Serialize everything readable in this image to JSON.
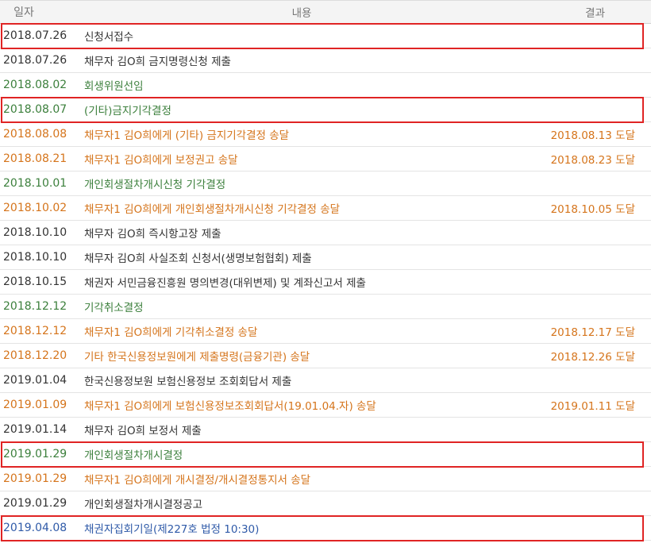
{
  "header": {
    "date": "일자",
    "content": "내용",
    "result": "결과"
  },
  "rows": [
    {
      "date": "2018.07.26",
      "content": "신청서접수",
      "result": "",
      "tone": "black",
      "highlighted": true
    },
    {
      "date": "2018.07.26",
      "content": "채무자 김O희 금지명령신청 제출",
      "result": "",
      "tone": "black",
      "highlighted": false
    },
    {
      "date": "2018.08.02",
      "content": "회생위원선임",
      "result": "",
      "tone": "green",
      "highlighted": false
    },
    {
      "date": "2018.08.07",
      "content": "(기타)금지기각결정",
      "result": "",
      "tone": "green",
      "highlighted": true
    },
    {
      "date": "2018.08.08",
      "content": "채무자1 김O희에게 (기타) 금지기각결정 송달",
      "result": "2018.08.13 도달",
      "tone": "orange",
      "highlighted": false
    },
    {
      "date": "2018.08.21",
      "content": "채무자1 김O희에게 보정권고 송달",
      "result": "2018.08.23 도달",
      "tone": "orange",
      "highlighted": false
    },
    {
      "date": "2018.10.01",
      "content": "개인회생절차개시신청 기각결정",
      "result": "",
      "tone": "green",
      "highlighted": false
    },
    {
      "date": "2018.10.02",
      "content": "채무자1 김O희에게 개인회생절차개시신청 기각결정 송달",
      "result": "2018.10.05 도달",
      "tone": "orange",
      "highlighted": false
    },
    {
      "date": "2018.10.10",
      "content": "채무자 김O희 즉시항고장 제출",
      "result": "",
      "tone": "black",
      "highlighted": false
    },
    {
      "date": "2018.10.10",
      "content": "채무자 김O희 사실조회 신청서(생명보험협회) 제출",
      "result": "",
      "tone": "black",
      "highlighted": false
    },
    {
      "date": "2018.10.15",
      "content": "채권자 서민금융진흥원 명의변경(대위변제) 및 계좌신고서 제출",
      "result": "",
      "tone": "black",
      "highlighted": false
    },
    {
      "date": "2018.12.12",
      "content": "기각취소결정",
      "result": "",
      "tone": "green",
      "highlighted": false
    },
    {
      "date": "2018.12.12",
      "content": "채무자1 김O희에게 기각취소결정 송달",
      "result": "2018.12.17 도달",
      "tone": "orange",
      "highlighted": false
    },
    {
      "date": "2018.12.20",
      "content": "기타 한국신용정보원에게 제출명령(금융기관) 송달",
      "result": "2018.12.26 도달",
      "tone": "orange",
      "highlighted": false
    },
    {
      "date": "2019.01.04",
      "content": "한국신용정보원 보험신용정보 조회회답서 제출",
      "result": "",
      "tone": "black",
      "highlighted": false
    },
    {
      "date": "2019.01.09",
      "content": "채무자1 김O희에게 보험신용정보조회회답서(19.01.04.자) 송달",
      "result": "2019.01.11 도달",
      "tone": "orange",
      "highlighted": false
    },
    {
      "date": "2019.01.14",
      "content": "채무자 김O희 보정서 제출",
      "result": "",
      "tone": "black",
      "highlighted": false
    },
    {
      "date": "2019.01.29",
      "content": "개인회생절차개시결정",
      "result": "",
      "tone": "green",
      "highlighted": true
    },
    {
      "date": "2019.01.29",
      "content": "채무자1 김O희에게 개시결정/개시결정통지서 송달",
      "result": "",
      "tone": "orange",
      "highlighted": false
    },
    {
      "date": "2019.01.29",
      "content": "개인회생절차개시결정공고",
      "result": "",
      "tone": "black",
      "highlighted": false
    },
    {
      "date": "2019.04.08",
      "content": "채권자집회기일(제227호 법정 10:30)",
      "result": "",
      "tone": "blue",
      "highlighted": true
    }
  ],
  "colors": {
    "black": "#333333",
    "green": "#3b7f3b",
    "orange": "#d5741b",
    "blue": "#2f5aa8",
    "highlight": "#e02424"
  }
}
